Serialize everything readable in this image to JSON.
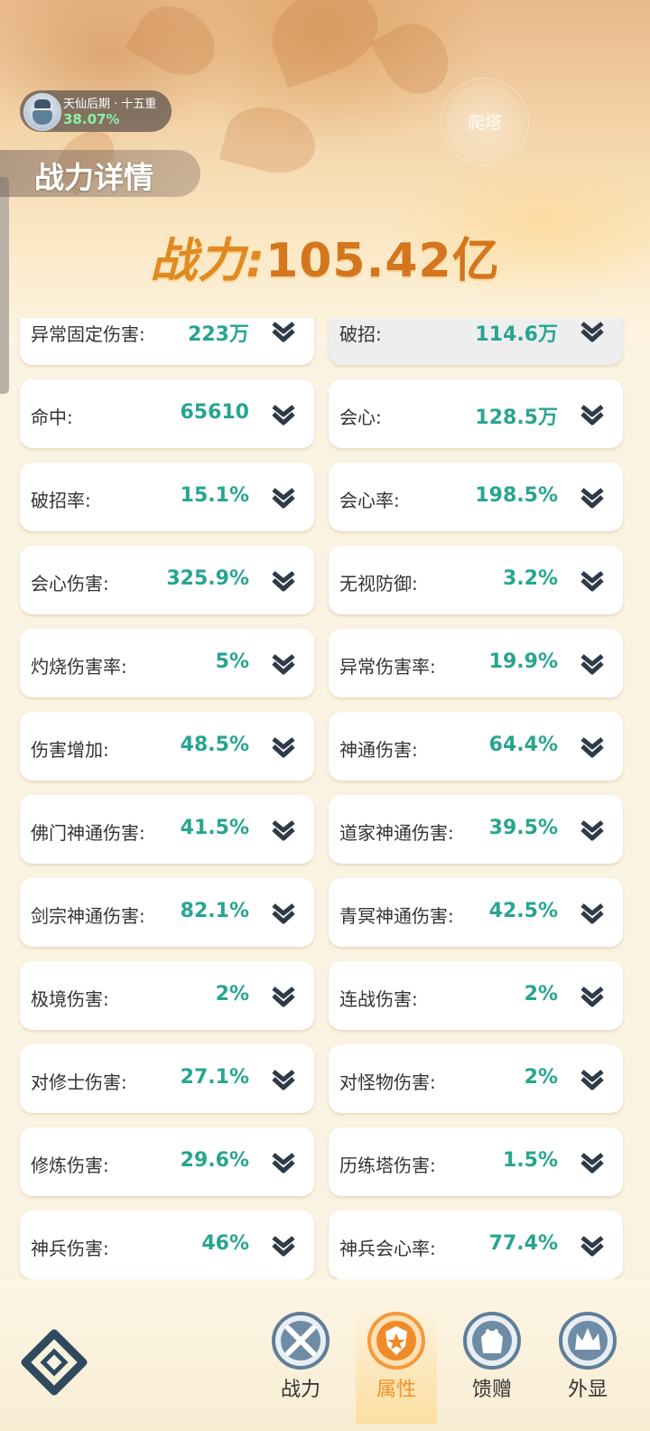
{
  "header": {
    "realm_name": "天仙后期 · 十五重",
    "realm_progress": "38.07%",
    "tower_button": "爬塔",
    "page_title": "战力详情",
    "power_label": "战力:",
    "power_value": "105.42亿"
  },
  "stats": [
    {
      "label": "异常固定伤害:",
      "value": "223万"
    },
    {
      "label": "破招:",
      "value": "114.6万"
    },
    {
      "label": "命中:",
      "value": "65610"
    },
    {
      "label": "会心:",
      "value": "128.5万"
    },
    {
      "label": "破招率:",
      "value": "15.1%"
    },
    {
      "label": "会心率:",
      "value": "198.5%"
    },
    {
      "label": "会心伤害:",
      "value": "325.9%"
    },
    {
      "label": "无视防御:",
      "value": "3.2%"
    },
    {
      "label": "灼烧伤害率:",
      "value": "5%"
    },
    {
      "label": "异常伤害率:",
      "value": "19.9%"
    },
    {
      "label": "伤害增加:",
      "value": "48.5%"
    },
    {
      "label": "神通伤害:",
      "value": "64.4%"
    },
    {
      "label": "佛门神通伤害:",
      "value": "41.5%"
    },
    {
      "label": "道家神通伤害:",
      "value": "39.5%"
    },
    {
      "label": "剑宗神通伤害:",
      "value": "82.1%"
    },
    {
      "label": "青冥神通伤害:",
      "value": "42.5%"
    },
    {
      "label": "极境伤害:",
      "value": "2%"
    },
    {
      "label": "连战伤害:",
      "value": "2%"
    },
    {
      "label": "对修士伤害:",
      "value": "27.1%"
    },
    {
      "label": "对怪物伤害:",
      "value": "2%"
    },
    {
      "label": "修炼伤害:",
      "value": "29.6%"
    },
    {
      "label": "历练塔伤害:",
      "value": "1.5%"
    },
    {
      "label": "神兵伤害:",
      "value": "46%"
    },
    {
      "label": "神兵会心率:",
      "value": "77.4%"
    }
  ],
  "nav": [
    {
      "label": "战力",
      "icon": "crossed-swords-icon"
    },
    {
      "label": "属性",
      "icon": "shield-star-icon",
      "active": true
    },
    {
      "label": "馈赠",
      "icon": "gift-bag-icon"
    },
    {
      "label": "外显",
      "icon": "crown-icon"
    }
  ],
  "colors": {
    "value_teal": "#27a58f",
    "power_orange": "#d3761e",
    "active_nav": "#ef9326",
    "chevron": "#2f3a48"
  }
}
